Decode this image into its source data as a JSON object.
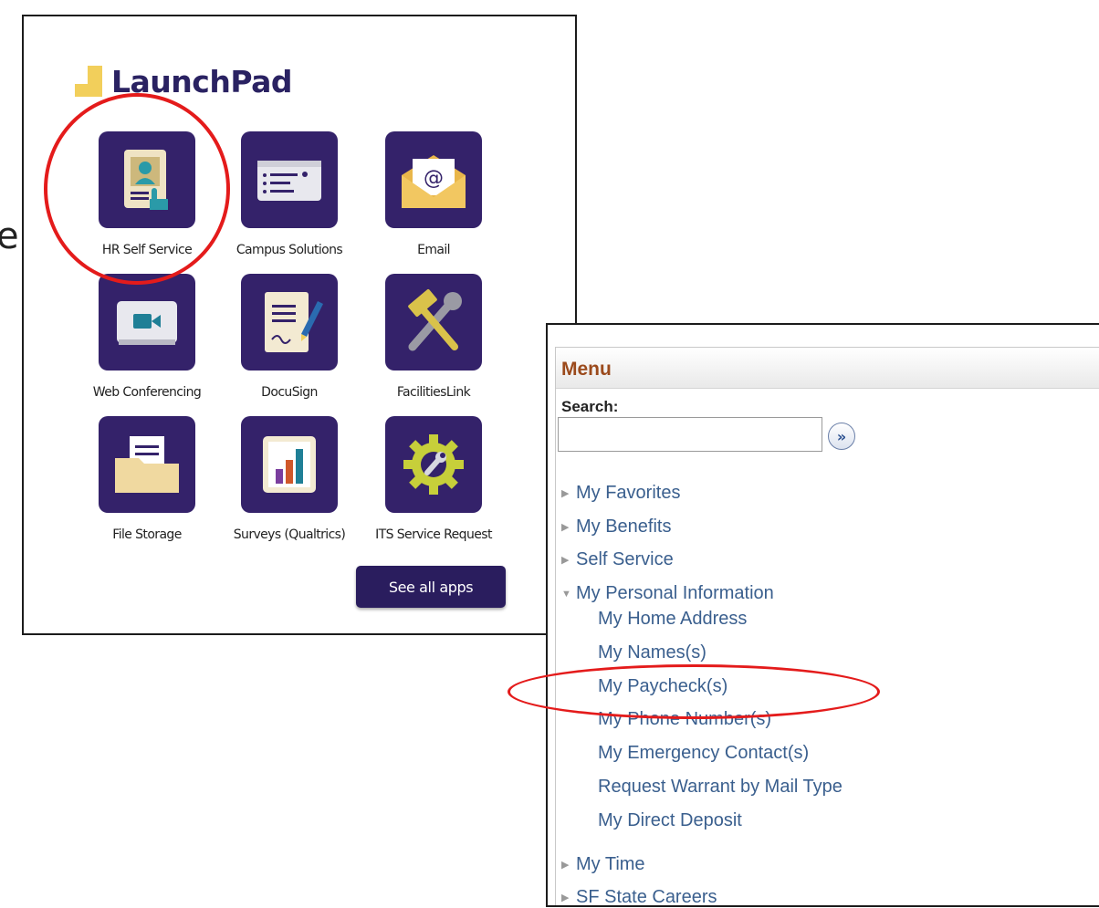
{
  "page_edge_text": "e",
  "launchpad": {
    "title": "LaunchPad",
    "apps": [
      {
        "label": "HR Self Service",
        "icon": "id-card-hand-icon"
      },
      {
        "label": "Campus Solutions",
        "icon": "form-card-icon"
      },
      {
        "label": "Email",
        "icon": "envelope-at-icon"
      },
      {
        "label": "Web Conferencing",
        "icon": "video-camera-icon"
      },
      {
        "label": "DocuSign",
        "icon": "document-pen-icon"
      },
      {
        "label": "FacilitiesLink",
        "icon": "hammer-wrench-icon"
      },
      {
        "label": "File Storage",
        "icon": "folder-icon"
      },
      {
        "label": "Surveys (Qualtrics)",
        "icon": "bar-chart-icon"
      },
      {
        "label": "ITS Service Request",
        "icon": "gear-wrench-icon"
      }
    ],
    "see_all_label": "See all apps"
  },
  "menu": {
    "title": "Menu",
    "search_label": "Search:",
    "search_value": "",
    "search_go_symbol": "»",
    "items": [
      {
        "label": "My Favorites",
        "state": "collapsed"
      },
      {
        "label": "My Benefits",
        "state": "collapsed"
      },
      {
        "label": "Self Service",
        "state": "collapsed"
      },
      {
        "label": "My Personal Information",
        "state": "expanded"
      }
    ],
    "sub_items": [
      "My Home Address",
      "My Names(s)",
      "My Paycheck(s)",
      "My Phone Number(s)",
      "My Emergency Contact(s)",
      "Request Warrant by Mail Type",
      "My Direct Deposit"
    ],
    "bottom_items": [
      {
        "label": "My Time",
        "state": "collapsed"
      },
      {
        "label": "SF State Careers",
        "state": "collapsed"
      }
    ]
  },
  "colors": {
    "tile_purple": "#34226a",
    "highlight_red": "#e41b1b",
    "menu_title": "#9b4a1c",
    "menu_link": "#3a5f8e"
  }
}
